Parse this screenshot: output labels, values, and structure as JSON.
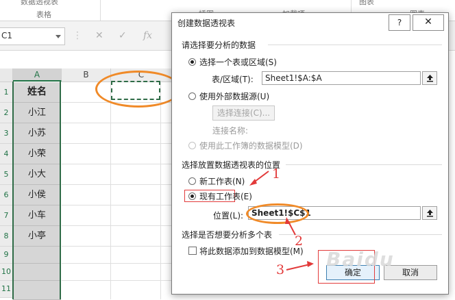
{
  "ribbon": {
    "top_fragment_left": "数据透视表",
    "group_table": "表格",
    "frag_illustration": "插图",
    "frag_addins": "加载项",
    "frag_chart_head": "图表",
    "frag_chart_label": "图表"
  },
  "formula_bar": {
    "name_box": "C1",
    "cancel_icon": "✕",
    "enter_icon": "✓",
    "fx_icon": "fx"
  },
  "sheet": {
    "columns": [
      "A",
      "B",
      "C"
    ],
    "rows": [
      "1",
      "2",
      "3",
      "4",
      "5",
      "6",
      "7",
      "8",
      "9",
      "10",
      "11"
    ],
    "column_a": [
      "姓名",
      "小江",
      "小苏",
      "小荣",
      "小大",
      "小侯",
      "小车",
      "小亭",
      "",
      "",
      ""
    ]
  },
  "dialog": {
    "title": "创建数据透视表",
    "help": "?",
    "close": "✕",
    "section1": "请选择要分析的数据",
    "opt_select_range": "选择一个表或区域(S)",
    "range_label": "表/区域(T):",
    "range_value": "Sheet1!$A:$A",
    "opt_external": "使用外部数据源(U)",
    "choose_conn_btn": "选择连接(C)...",
    "conn_name_label": "连接名称:",
    "opt_data_model": "使用此工作簿的数据模型(D)",
    "section2": "选择放置数据透视表的位置",
    "opt_new_sheet": "新工作表(N)",
    "opt_existing_sheet": "现有工作表(E)",
    "location_label": "位置(L):",
    "location_value": "Sheet1!$C$1",
    "section3": "选择是否想要分析多个表",
    "add_to_model": "将此数据添加到数据模型(M)",
    "ok": "确定",
    "cancel": "取消"
  },
  "annotations": {
    "step1": "1",
    "step2": "2",
    "step3": "3",
    "color_red": "#e23a3a",
    "color_orange": "#f08a28"
  },
  "watermark": "Baidu"
}
